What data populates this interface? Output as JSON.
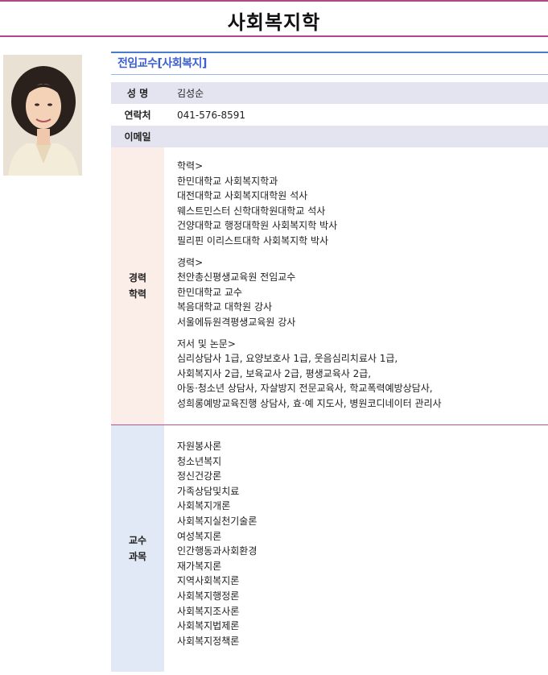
{
  "header": {
    "title": "사회복지학"
  },
  "section": {
    "title": "전임교수[사회복지]"
  },
  "info": {
    "name_label": "성 명",
    "name_value": "김성순",
    "contact_label": "연락처",
    "contact_value": "041-576-8591",
    "email_label": "이메일",
    "email_value": ""
  },
  "career": {
    "label_line1": "경력",
    "label_line2": "학력",
    "education": {
      "heading": "학력>",
      "items": [
        "한민대학교 사회복지학과",
        "대전대학교 사회복지대학원 석사",
        "웨스트민스터 신학대학원대학교 석사",
        "건양대학교 행정대학원 사회복지학 박사",
        "필리핀 이리스트대학 사회복지학 박사"
      ]
    },
    "experience": {
      "heading": "경력>",
      "items": [
        "천안총신평생교육원 전임교수",
        "한민대학교 교수",
        "복음대학교 대학원 강사",
        "서울에듀원격평생교육원 강사"
      ]
    },
    "publications": {
      "heading": "저서 및 논문>",
      "items": [
        "심리상담사 1급, 요양보호사 1급, 웃음심리치료사 1급,",
        "사회복지사 2급, 보육교사 2급, 평생교육사 2급,",
        "아동·청소년 상담사, 자살방지 전문교육사, 학교폭력예방상담사,",
        "성희롱예방교육진행 상담사, 효·예 지도사, 병원코디네이터 관리사"
      ]
    }
  },
  "courses": {
    "label_line1": "교수",
    "label_line2": "과목",
    "items": [
      "자원봉사론",
      "청소년복지",
      "정신건강론",
      "가족상담및치료",
      "사회복지개론",
      "사회복지실천기술론",
      "여성복지론",
      "인간행동과사회환경",
      "재가복지론",
      "지역사회복지론",
      "사회복지행정론",
      "사회복지조사론",
      "사회복지법제론",
      "사회복지정책론"
    ]
  },
  "colors": {
    "accent_rule": "#b0468c",
    "section_title": "#3b5fd0",
    "career_bg": "#fbeee8",
    "courses_bg": "#e0e9f5",
    "info_alt_bg": "#e4e4f0"
  }
}
